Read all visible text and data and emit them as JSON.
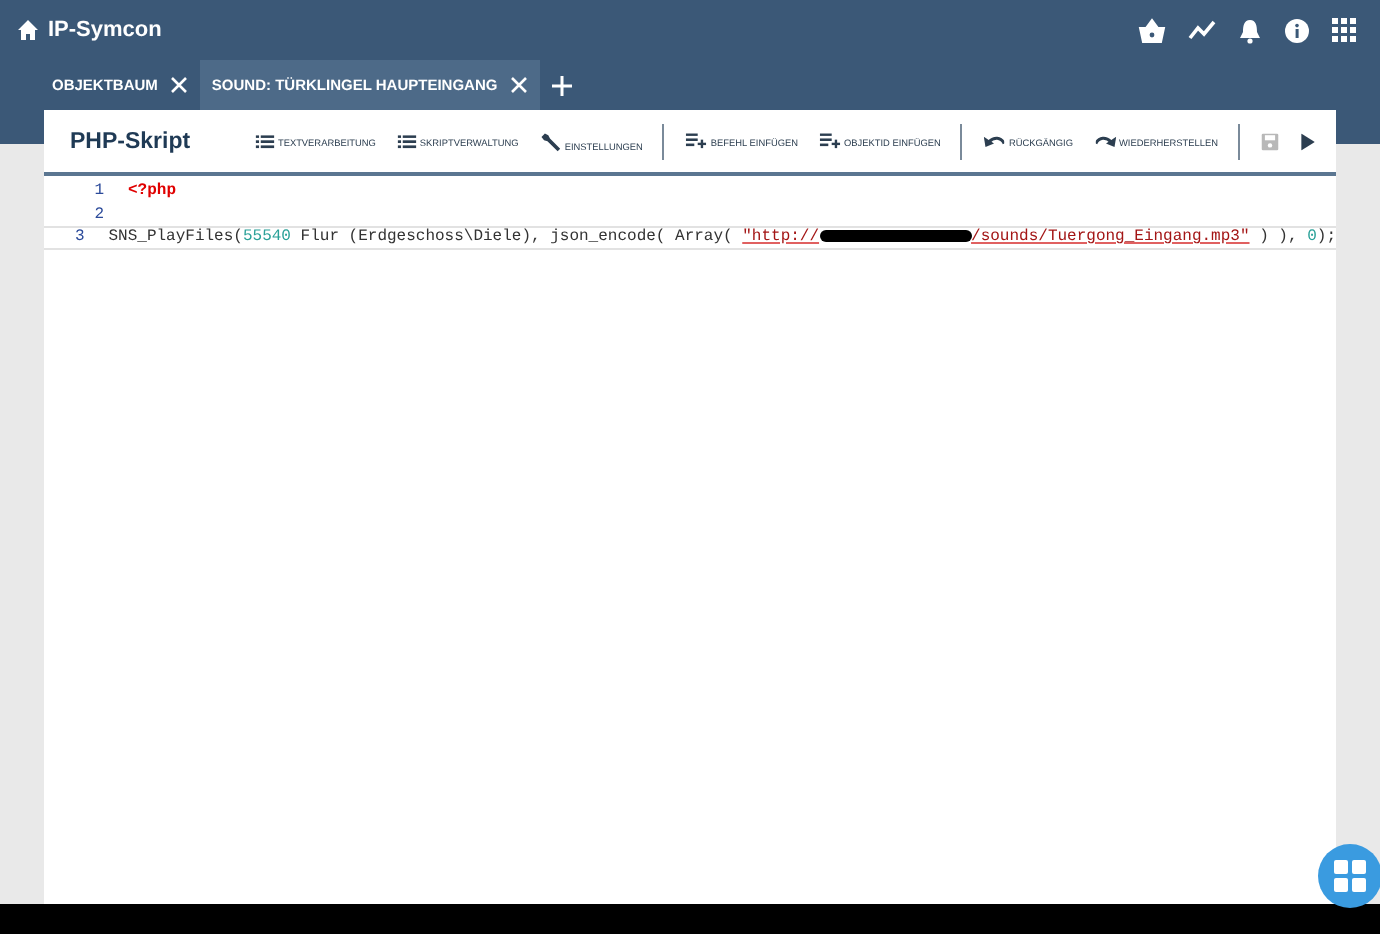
{
  "app": {
    "title": "IP-Symcon"
  },
  "header_icons": [
    {
      "kind": "basket"
    },
    {
      "kind": "chart"
    },
    {
      "kind": "bell"
    },
    {
      "kind": "info"
    },
    {
      "kind": "apps"
    }
  ],
  "tabs": [
    {
      "label": "OBJEKTBAUM",
      "selected": false
    },
    {
      "label": "SOUND: TÜRKLINGEL HAUPTEINGANG",
      "selected": true
    }
  ],
  "editor": {
    "title": "PHP-Skript",
    "toolbar": [
      {
        "kind": "list",
        "label": "TEXTVERARBEITUNG"
      },
      {
        "kind": "list",
        "label": "SKRIPTVERWALTUNG"
      },
      {
        "kind": "wrench",
        "label": "EINSTELLUNGEN"
      },
      {
        "kind": "separator"
      },
      {
        "kind": "insert",
        "label": "BEFEHL EINFÜGEN"
      },
      {
        "kind": "insert",
        "label": "OBJEKTID EINFÜGEN"
      },
      {
        "kind": "separator"
      },
      {
        "kind": "undo",
        "label": "RÜCKGÄNGIG"
      },
      {
        "kind": "redo",
        "label": "WIEDERHERSTELLEN"
      },
      {
        "kind": "separator"
      },
      {
        "kind": "save",
        "disabled": true
      },
      {
        "kind": "play",
        "disabled": false
      }
    ],
    "lines": [
      {
        "number": "1",
        "current": false,
        "tokens": [
          {
            "kind": "tag",
            "text": "<?php"
          }
        ]
      },
      {
        "number": "2",
        "current": false
      },
      {
        "number": "3",
        "current": true,
        "tokens": [
          {
            "kind": "plain",
            "text": "SNS_PlayFiles("
          },
          {
            "kind": "number",
            "text": "55540"
          },
          {
            "kind": "plain",
            "text": " Flur (Erdgeschoss\\Diele), json_encode( Array( "
          },
          {
            "kind": "string",
            "text": "\"http://"
          },
          {
            "kind": "redaction"
          },
          {
            "kind": "string",
            "text": "/sounds/Tuergong_Eingang.mp3\""
          },
          {
            "kind": "plain",
            "text": " ) ), "
          },
          {
            "kind": "number",
            "text": "0"
          },
          {
            "kind": "plain",
            "text": ");"
          }
        ]
      }
    ]
  }
}
